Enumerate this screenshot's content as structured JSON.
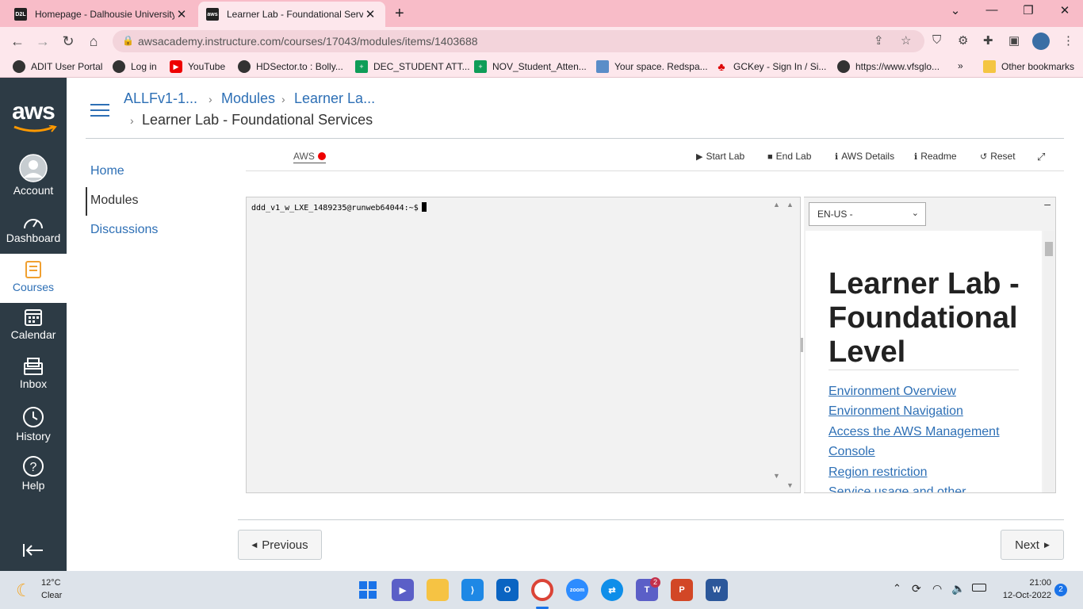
{
  "browser": {
    "tabs": [
      {
        "title": "Homepage - Dalhousie University",
        "favicon": "D2L"
      },
      {
        "title": "Learner Lab - Foundational Servic",
        "favicon": "aws"
      }
    ],
    "url": "awsacademy.instructure.com/courses/17043/modules/items/1403688",
    "bookmarks": [
      "ADIT User Portal",
      "Log in",
      "YouTube",
      "HDSector.to : Bolly...",
      "DEC_STUDENT ATT...",
      "NOV_Student_Atten...",
      "Your space. Redspa...",
      "GCKey - Sign In / Si...",
      "https://www.vfsglo...",
      "Other bookmarks"
    ],
    "overflow": "»"
  },
  "leftnav": {
    "logo": "aws",
    "items": [
      {
        "label": "Account",
        "icon": "account-icon"
      },
      {
        "label": "Dashboard",
        "icon": "dashboard-icon"
      },
      {
        "label": "Courses",
        "icon": "courses-icon"
      },
      {
        "label": "Calendar",
        "icon": "calendar-icon"
      },
      {
        "label": "Inbox",
        "icon": "inbox-icon"
      },
      {
        "label": "History",
        "icon": "history-icon"
      },
      {
        "label": "Help",
        "icon": "help-icon"
      }
    ],
    "collapse_icon": "collapse-icon"
  },
  "breadcrumb": {
    "course": "ALLFv1-1...",
    "modules": "Modules",
    "item": "Learner La...",
    "current": "Learner Lab - Foundational Services"
  },
  "course_nav": [
    "Home",
    "Modules",
    "Discussions"
  ],
  "lab": {
    "aws_label": "AWS",
    "aws_status_color": "#e00000",
    "buttons": [
      "Start Lab",
      "End Lab",
      "AWS Details",
      "Readme",
      "Reset"
    ],
    "terminal_prompt": "ddd_v1_w_LXE_1489235@runweb64044:~$"
  },
  "readme": {
    "language": "EN-US -",
    "title": "Learner Lab - Foundational Level",
    "links": [
      "Environment Overview",
      "Environment Navigation",
      "Access the AWS Management",
      "Console",
      "Region restriction",
      "Service usage and other"
    ]
  },
  "pager": {
    "previous": "Previous",
    "next": "Next"
  },
  "taskbar": {
    "temperature": "12°C",
    "weather": "Clear",
    "time": "21:00",
    "date": "12-Oct-2022",
    "notifications": "2",
    "teams_badge": "2"
  },
  "colors": {
    "accent": "#2d6fb5",
    "nav_bg": "#2d3b45",
    "tab_strip": "#f8bcc8"
  }
}
